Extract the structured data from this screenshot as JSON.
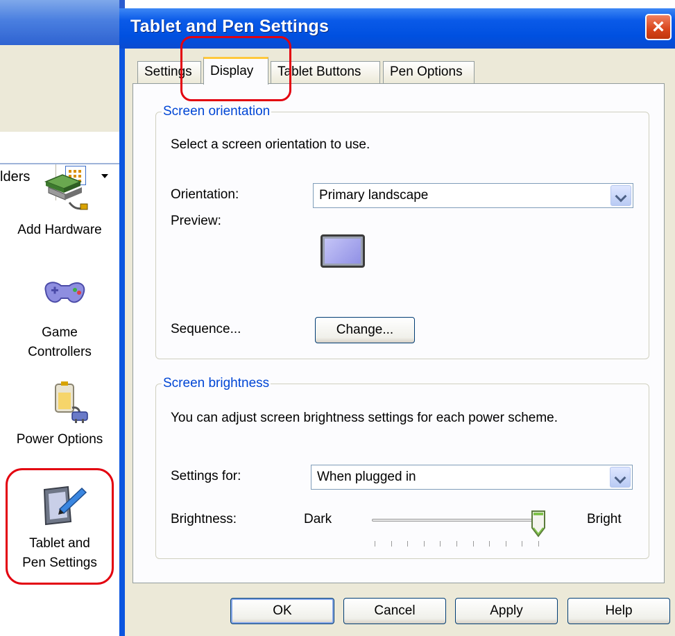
{
  "background_window": {
    "toolbar_folders_label": "lders",
    "items": [
      {
        "label_lines": [
          "Add Hardware"
        ],
        "icon": "add-hardware-icon"
      },
      {
        "label_lines": [
          "Game",
          "Controllers"
        ],
        "icon": "game-controller-icon"
      },
      {
        "label_lines": [
          "Power Options"
        ],
        "icon": "power-options-icon"
      },
      {
        "label_lines": [
          "Tablet and",
          "Pen Settings"
        ],
        "icon": "tablet-pen-icon"
      }
    ]
  },
  "dialog": {
    "title": "Tablet and Pen Settings",
    "close_label": "×",
    "tabs": [
      {
        "label": "Settings",
        "active": false
      },
      {
        "label": "Display",
        "active": true
      },
      {
        "label": "Tablet Buttons",
        "active": false
      },
      {
        "label": "Pen Options",
        "active": false
      }
    ],
    "orientation_group": {
      "legend": "Screen orientation",
      "description": "Select a screen orientation to use.",
      "orientation_label": "Orientation:",
      "orientation_value": "Primary landscape",
      "preview_label": "Preview:",
      "sequence_label": "Sequence...",
      "change_button": "Change..."
    },
    "brightness_group": {
      "legend": "Screen brightness",
      "description": "You can adjust screen brightness settings for each power scheme.",
      "settings_for_label": "Settings for:",
      "settings_for_value": "When plugged in",
      "brightness_label": "Brightness:",
      "dark_label": "Dark",
      "bright_label": "Bright",
      "brightness_level": 1.0
    },
    "buttons": {
      "ok": "OK",
      "cancel": "Cancel",
      "apply": "Apply",
      "help": "Help"
    }
  },
  "colors": {
    "highlight": "#e3000f",
    "title_bar": "#0a5ae8",
    "group_legend": "#0046d5"
  }
}
